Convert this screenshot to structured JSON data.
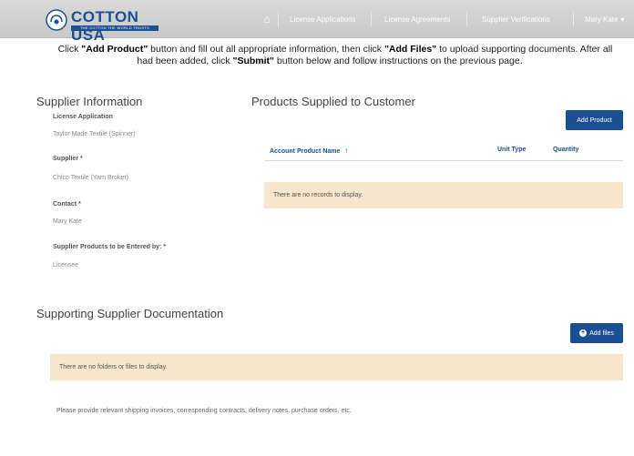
{
  "header": {
    "logo_text": "COTTON USA",
    "logo_tagline": "THE COTTON THE WORLD TRUSTS",
    "nav": {
      "license_applications": "License Applications",
      "license_agreements": "License Agreements",
      "supplier_verifications": "Supplier Verifications",
      "user_menu": "Mary Kate"
    }
  },
  "instructions": {
    "part1": "Click ",
    "add_product": "\"Add Product\"",
    "part2": " button and fill out all appropriate information, then click ",
    "add_files": "\"Add Files\"",
    "part3": " to upload supporting documents.  After all",
    "part4": "had been added, click ",
    "submit": "\"Submit\"",
    "part5": " button below and follow instructions on the previous page."
  },
  "supplier_info": {
    "title": "Supplier Information",
    "fields": [
      {
        "label": "License Application",
        "value": "Taylor Made Textile (Spinner)"
      },
      {
        "label": "Supplier *",
        "value": "Chico Textile (Yarn Broker)"
      },
      {
        "label": "Contact *",
        "value": "Mary Kate"
      },
      {
        "label": "Supplier Products to be Entered by: *",
        "value": "Licensee"
      }
    ]
  },
  "products": {
    "title": "Products Supplied to Customer",
    "add_button": "Add Product",
    "columns": {
      "name": "Account Product Name",
      "sort_icon": "↑",
      "unit": "Unit Type",
      "quantity": "Quantity"
    },
    "empty_message": "There are no records to display."
  },
  "documentation": {
    "title": "Supporting Supplier Documentation",
    "add_button": "Add files",
    "empty_message": "There are no folders or files to display.",
    "note": "Please provide relevant shipping invoices, corresponding contracts, delivery notes, purchase orders, etc."
  },
  "colors": {
    "brand": "#1b4f93",
    "notice_bg": "#f5e6cc",
    "header_bg": "#cfcfcf"
  }
}
